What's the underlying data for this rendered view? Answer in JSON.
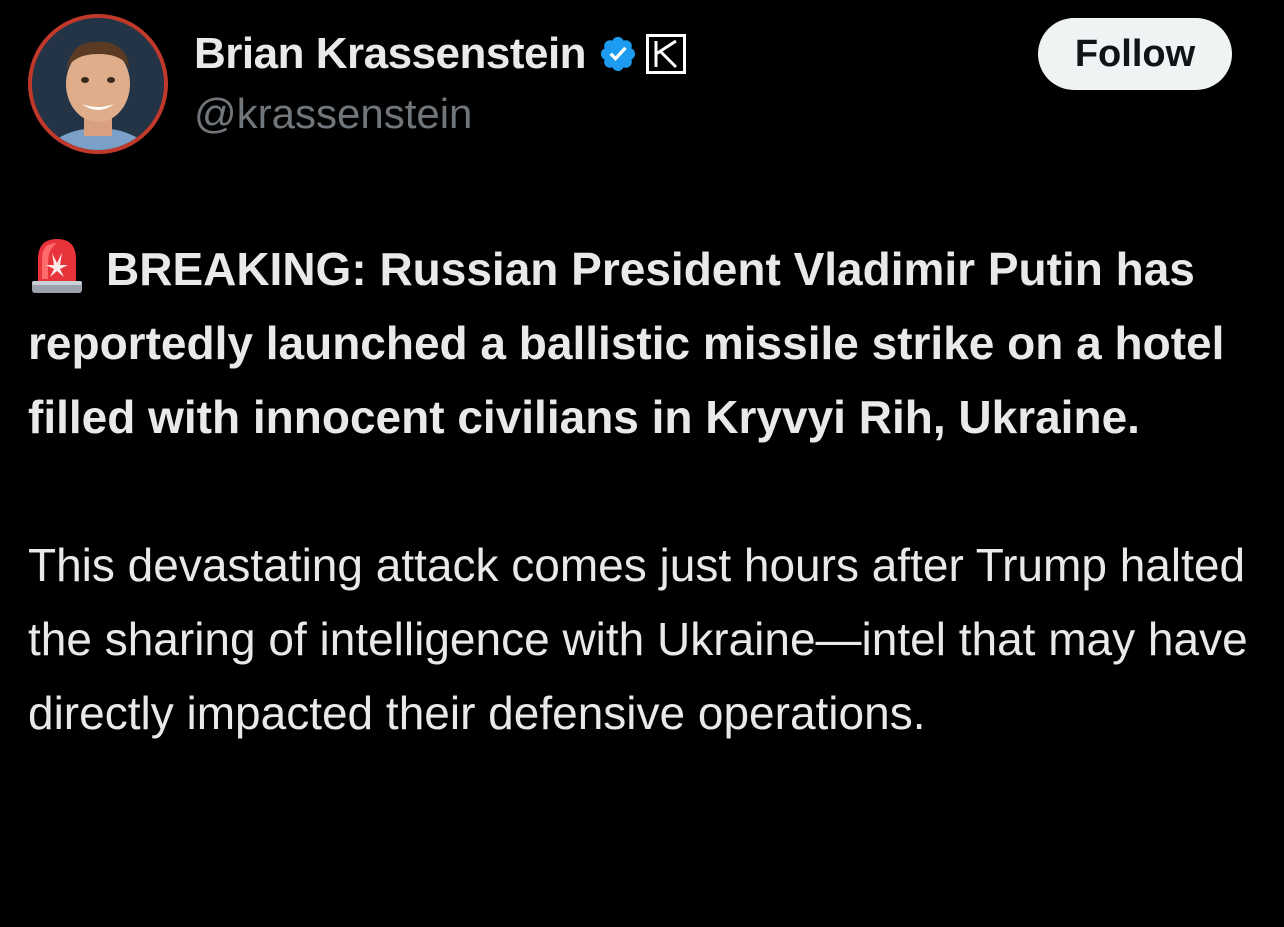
{
  "author": {
    "display_name": "Brian Krassenstein",
    "handle": "@krassenstein",
    "verified_icon": "verified-badge-icon",
    "affiliate_icon": "k-affiliate-badge-icon",
    "follow_label": "Follow"
  },
  "post": {
    "leading_icon": "siren-emoji-icon",
    "headline": "BREAKING: Russian President Vladimir Putin has reportedly launched a ballistic missile strike on a hotel filled with innocent civilians in Kryvyi Rih, Ukraine.",
    "body": "This devastating attack comes just hours after Trump halted the sharing of intelligence with Ukraine—intel that may have directly impacted their defensive operations."
  },
  "colors": {
    "background": "#000000",
    "text": "#e7e9ea",
    "secondary_text": "#71767b",
    "verified_blue": "#1d9bf0",
    "follow_bg": "#eff3f4"
  }
}
